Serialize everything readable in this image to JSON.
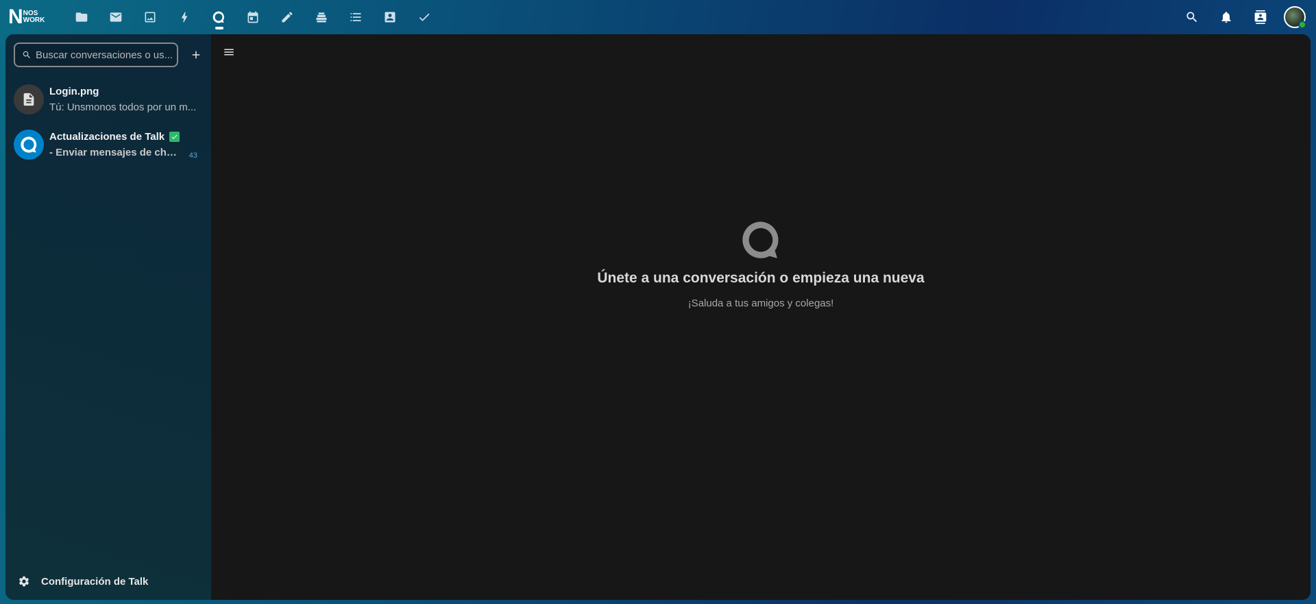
{
  "brand": {
    "logo_letter": "N",
    "logo_line1": "NOS",
    "logo_line2": "WORK"
  },
  "apps": [
    {
      "name": "files-icon"
    },
    {
      "name": "mail-icon"
    },
    {
      "name": "photos-icon"
    },
    {
      "name": "activity-icon"
    },
    {
      "name": "talk-icon",
      "active": true
    },
    {
      "name": "calendar-icon"
    },
    {
      "name": "notes-icon"
    },
    {
      "name": "deck-icon"
    },
    {
      "name": "tasks-icon"
    },
    {
      "name": "contacts-icon"
    },
    {
      "name": "checkmark-icon"
    }
  ],
  "sidebar": {
    "search_placeholder": "Buscar conversaciones o us...",
    "conversations": [
      {
        "title": "Login.png",
        "subtitle": "Tú: Unsmonos todos por un m...",
        "avatar_icon": "document-icon",
        "avatar_color": "#3a3a3a"
      },
      {
        "title": "Actualizaciones de Talk",
        "subtitle": "- Enviar mensajes de cha...",
        "avatar_icon": "talk-logo-icon",
        "avatar_color": "#0082c9",
        "unread": "43",
        "verified": true
      }
    ],
    "settings_label": "Configuración de Talk"
  },
  "main": {
    "empty_title": "Únete a una conversación o empieza una nueva",
    "empty_subtitle": "¡Saluda a tus amigos y colegas!"
  },
  "colors": {
    "accent": "#0082c9",
    "verified": "#2fb86a",
    "online": "#2fb130",
    "counter": "#4da8e8"
  }
}
